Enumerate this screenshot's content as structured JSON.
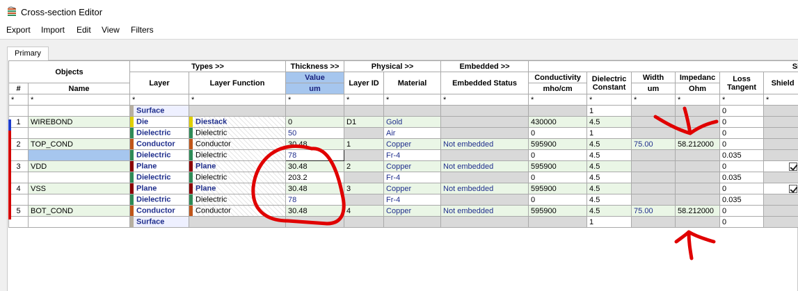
{
  "window": {
    "title": "Cross-section Editor"
  },
  "menu": [
    "Export",
    "Import",
    "Edit",
    "View",
    "Filters"
  ],
  "tab": "Primary",
  "header_groups": {
    "objects": "Objects",
    "types": "Types >>",
    "thickness": "Thickness >>",
    "physical": "Physical >>",
    "embedded": "Embedded >>",
    "si": "Si"
  },
  "columns": {
    "num": "#",
    "name": "Name",
    "layer": "Layer",
    "layer_function": "Layer Function",
    "value": "Value",
    "um": "um",
    "layer_id": "Layer ID",
    "material": "Material",
    "embedded_status": "Embedded Status",
    "conductivity": "Conductivity",
    "conductivity_unit": "mho/cm",
    "dielectric1": "Dielectric",
    "dielectric2": "Constant",
    "width": "Width",
    "width_unit": "um",
    "impedance": "Impedanc",
    "impedance_unit": "Ohm",
    "loss1": "Loss",
    "loss2": "Tangent",
    "shield": "Shield"
  },
  "filter": "*",
  "colors": {
    "die": "#e0d000",
    "dielectric": "#2e8b57",
    "conductor": "#c0561a",
    "plane": "#8b0000",
    "surface": "#b8b0a0",
    "annotation": "#d40000"
  },
  "rows": [
    {
      "num": "",
      "name": "",
      "layer": "Surface",
      "lf": "",
      "thick": "",
      "lid": "",
      "mat": "",
      "emb": "",
      "cond": "",
      "dk": "1",
      "w": "",
      "z": "",
      "loss": "0",
      "shield": false
    },
    {
      "num": "1",
      "name": "WIREBOND",
      "layer": "Die",
      "lf": "Diestack",
      "thick": "0",
      "lid": "D1",
      "mat": "Gold",
      "emb": "",
      "cond": "430000",
      "dk": "4.5",
      "w": "",
      "z": "",
      "loss": "0",
      "shield": false
    },
    {
      "num": "",
      "name": "",
      "layer": "Dielectric",
      "lf": "Dielectric",
      "thick": "50",
      "lid": "",
      "mat": "Air",
      "emb": "",
      "cond": "0",
      "dk": "1",
      "w": "",
      "z": "",
      "loss": "0",
      "shield": false
    },
    {
      "num": "2",
      "name": "TOP_COND",
      "layer": "Conductor",
      "lf": "Conductor",
      "thick": "30.48",
      "lid": "1",
      "mat": "Copper",
      "emb": "Not embedded",
      "cond": "595900",
      "dk": "4.5",
      "w": "75.00",
      "z": "58.212000",
      "loss": "0",
      "shield": false
    },
    {
      "num": "",
      "name": "",
      "layer": "Dielectric",
      "lf": "Dielectric",
      "thick": "78",
      "lid": "",
      "mat": "Fr-4",
      "emb": "",
      "cond": "0",
      "dk": "4.5",
      "w": "",
      "z": "",
      "loss": "0.035",
      "shield": false
    },
    {
      "num": "3",
      "name": "VDD",
      "layer": "Plane",
      "lf": "Plane",
      "thick": "30.48",
      "lid": "2",
      "mat": "Copper",
      "emb": "Not embedded",
      "cond": "595900",
      "dk": "4.5",
      "w": "",
      "z": "",
      "loss": "0",
      "shield": true
    },
    {
      "num": "",
      "name": "",
      "layer": "Dielectric",
      "lf": "Dielectric",
      "thick": "203.2",
      "lid": "",
      "mat": "Fr-4",
      "emb": "",
      "cond": "0",
      "dk": "4.5",
      "w": "",
      "z": "",
      "loss": "0.035",
      "shield": false
    },
    {
      "num": "4",
      "name": "VSS",
      "layer": "Plane",
      "lf": "Plane",
      "thick": "30.48",
      "lid": "3",
      "mat": "Copper",
      "emb": "Not embedded",
      "cond": "595900",
      "dk": "4.5",
      "w": "",
      "z": "",
      "loss": "0",
      "shield": true
    },
    {
      "num": "",
      "name": "",
      "layer": "Dielectric",
      "lf": "Dielectric",
      "thick": "78",
      "lid": "",
      "mat": "Fr-4",
      "emb": "",
      "cond": "0",
      "dk": "4.5",
      "w": "",
      "z": "",
      "loss": "0.035",
      "shield": false
    },
    {
      "num": "5",
      "name": "BOT_COND",
      "layer": "Conductor",
      "lf": "Conductor",
      "thick": "30.48",
      "lid": "4",
      "mat": "Copper",
      "emb": "Not embedded",
      "cond": "595900",
      "dk": "4.5",
      "w": "75.00",
      "z": "58.212000",
      "loss": "0",
      "shield": false
    },
    {
      "num": "",
      "name": "",
      "layer": "Surface",
      "lf": "",
      "thick": "",
      "lid": "",
      "mat": "",
      "emb": "",
      "cond": "",
      "dk": "1",
      "w": "",
      "z": "",
      "loss": "0",
      "shield": false
    }
  ]
}
